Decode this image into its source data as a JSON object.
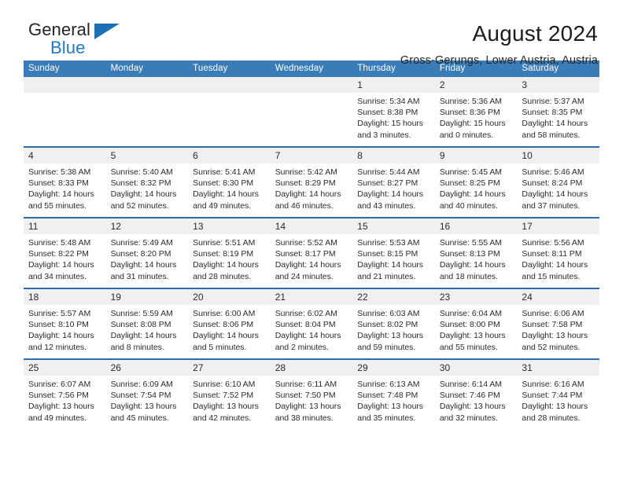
{
  "brand": {
    "name_top": "General",
    "name_bottom": "Blue",
    "triangle_color": "#1a6fb5",
    "blue_color": "#2079c4"
  },
  "header": {
    "title": "August 2024",
    "subtitle": "Gross-Gerungs, Lower Austria, Austria"
  },
  "theme": {
    "header_blue": "#3a7cb8",
    "row_divider_blue": "#2e6da4",
    "date_band_gray": "#f0f0f0"
  },
  "weekdays": [
    "Sunday",
    "Monday",
    "Tuesday",
    "Wednesday",
    "Thursday",
    "Friday",
    "Saturday"
  ],
  "weeks": [
    {
      "dates": [
        "",
        "",
        "",
        "",
        "1",
        "2",
        "3"
      ],
      "cells": [
        {
          "lines": []
        },
        {
          "lines": []
        },
        {
          "lines": []
        },
        {
          "lines": []
        },
        {
          "lines": [
            "Sunrise: 5:34 AM",
            "Sunset: 8:38 PM",
            "Daylight: 15 hours",
            "and 3 minutes."
          ]
        },
        {
          "lines": [
            "Sunrise: 5:36 AM",
            "Sunset: 8:36 PM",
            "Daylight: 15 hours",
            "and 0 minutes."
          ]
        },
        {
          "lines": [
            "Sunrise: 5:37 AM",
            "Sunset: 8:35 PM",
            "Daylight: 14 hours",
            "and 58 minutes."
          ]
        }
      ]
    },
    {
      "dates": [
        "4",
        "5",
        "6",
        "7",
        "8",
        "9",
        "10"
      ],
      "cells": [
        {
          "lines": [
            "Sunrise: 5:38 AM",
            "Sunset: 8:33 PM",
            "Daylight: 14 hours",
            "and 55 minutes."
          ]
        },
        {
          "lines": [
            "Sunrise: 5:40 AM",
            "Sunset: 8:32 PM",
            "Daylight: 14 hours",
            "and 52 minutes."
          ]
        },
        {
          "lines": [
            "Sunrise: 5:41 AM",
            "Sunset: 8:30 PM",
            "Daylight: 14 hours",
            "and 49 minutes."
          ]
        },
        {
          "lines": [
            "Sunrise: 5:42 AM",
            "Sunset: 8:29 PM",
            "Daylight: 14 hours",
            "and 46 minutes."
          ]
        },
        {
          "lines": [
            "Sunrise: 5:44 AM",
            "Sunset: 8:27 PM",
            "Daylight: 14 hours",
            "and 43 minutes."
          ]
        },
        {
          "lines": [
            "Sunrise: 5:45 AM",
            "Sunset: 8:25 PM",
            "Daylight: 14 hours",
            "and 40 minutes."
          ]
        },
        {
          "lines": [
            "Sunrise: 5:46 AM",
            "Sunset: 8:24 PM",
            "Daylight: 14 hours",
            "and 37 minutes."
          ]
        }
      ]
    },
    {
      "dates": [
        "11",
        "12",
        "13",
        "14",
        "15",
        "16",
        "17"
      ],
      "cells": [
        {
          "lines": [
            "Sunrise: 5:48 AM",
            "Sunset: 8:22 PM",
            "Daylight: 14 hours",
            "and 34 minutes."
          ]
        },
        {
          "lines": [
            "Sunrise: 5:49 AM",
            "Sunset: 8:20 PM",
            "Daylight: 14 hours",
            "and 31 minutes."
          ]
        },
        {
          "lines": [
            "Sunrise: 5:51 AM",
            "Sunset: 8:19 PM",
            "Daylight: 14 hours",
            "and 28 minutes."
          ]
        },
        {
          "lines": [
            "Sunrise: 5:52 AM",
            "Sunset: 8:17 PM",
            "Daylight: 14 hours",
            "and 24 minutes."
          ]
        },
        {
          "lines": [
            "Sunrise: 5:53 AM",
            "Sunset: 8:15 PM",
            "Daylight: 14 hours",
            "and 21 minutes."
          ]
        },
        {
          "lines": [
            "Sunrise: 5:55 AM",
            "Sunset: 8:13 PM",
            "Daylight: 14 hours",
            "and 18 minutes."
          ]
        },
        {
          "lines": [
            "Sunrise: 5:56 AM",
            "Sunset: 8:11 PM",
            "Daylight: 14 hours",
            "and 15 minutes."
          ]
        }
      ]
    },
    {
      "dates": [
        "18",
        "19",
        "20",
        "21",
        "22",
        "23",
        "24"
      ],
      "cells": [
        {
          "lines": [
            "Sunrise: 5:57 AM",
            "Sunset: 8:10 PM",
            "Daylight: 14 hours",
            "and 12 minutes."
          ]
        },
        {
          "lines": [
            "Sunrise: 5:59 AM",
            "Sunset: 8:08 PM",
            "Daylight: 14 hours",
            "and 8 minutes."
          ]
        },
        {
          "lines": [
            "Sunrise: 6:00 AM",
            "Sunset: 8:06 PM",
            "Daylight: 14 hours",
            "and 5 minutes."
          ]
        },
        {
          "lines": [
            "Sunrise: 6:02 AM",
            "Sunset: 8:04 PM",
            "Daylight: 14 hours",
            "and 2 minutes."
          ]
        },
        {
          "lines": [
            "Sunrise: 6:03 AM",
            "Sunset: 8:02 PM",
            "Daylight: 13 hours",
            "and 59 minutes."
          ]
        },
        {
          "lines": [
            "Sunrise: 6:04 AM",
            "Sunset: 8:00 PM",
            "Daylight: 13 hours",
            "and 55 minutes."
          ]
        },
        {
          "lines": [
            "Sunrise: 6:06 AM",
            "Sunset: 7:58 PM",
            "Daylight: 13 hours",
            "and 52 minutes."
          ]
        }
      ]
    },
    {
      "dates": [
        "25",
        "26",
        "27",
        "28",
        "29",
        "30",
        "31"
      ],
      "cells": [
        {
          "lines": [
            "Sunrise: 6:07 AM",
            "Sunset: 7:56 PM",
            "Daylight: 13 hours",
            "and 49 minutes."
          ]
        },
        {
          "lines": [
            "Sunrise: 6:09 AM",
            "Sunset: 7:54 PM",
            "Daylight: 13 hours",
            "and 45 minutes."
          ]
        },
        {
          "lines": [
            "Sunrise: 6:10 AM",
            "Sunset: 7:52 PM",
            "Daylight: 13 hours",
            "and 42 minutes."
          ]
        },
        {
          "lines": [
            "Sunrise: 6:11 AM",
            "Sunset: 7:50 PM",
            "Daylight: 13 hours",
            "and 38 minutes."
          ]
        },
        {
          "lines": [
            "Sunrise: 6:13 AM",
            "Sunset: 7:48 PM",
            "Daylight: 13 hours",
            "and 35 minutes."
          ]
        },
        {
          "lines": [
            "Sunrise: 6:14 AM",
            "Sunset: 7:46 PM",
            "Daylight: 13 hours",
            "and 32 minutes."
          ]
        },
        {
          "lines": [
            "Sunrise: 6:16 AM",
            "Sunset: 7:44 PM",
            "Daylight: 13 hours",
            "and 28 minutes."
          ]
        }
      ]
    }
  ]
}
